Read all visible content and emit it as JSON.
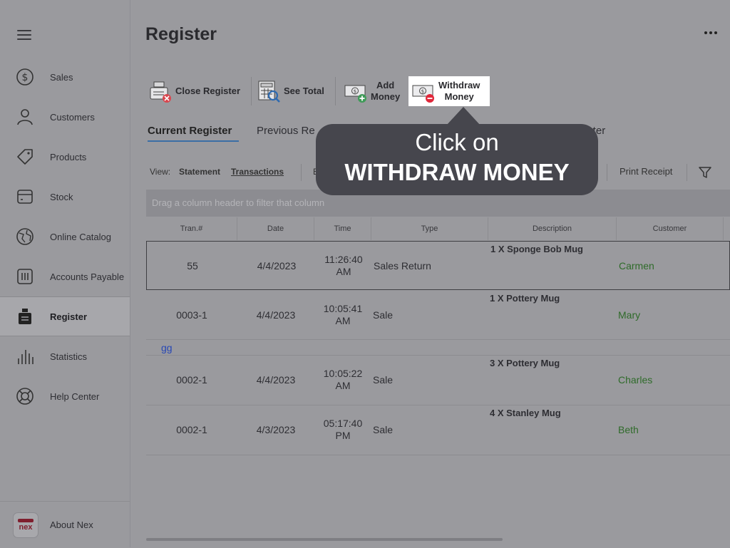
{
  "sidebar": {
    "items": [
      {
        "label": "Sales",
        "icon": "dollar-circle-icon"
      },
      {
        "label": "Customers",
        "icon": "person-icon"
      },
      {
        "label": "Products",
        "icon": "tag-icon"
      },
      {
        "label": "Stock",
        "icon": "box-icon"
      },
      {
        "label": "Online Catalog",
        "icon": "globe-icon"
      },
      {
        "label": "Accounts Payable",
        "icon": "invoice-icon"
      },
      {
        "label": "Register",
        "icon": "cash-register-icon"
      },
      {
        "label": "Statistics",
        "icon": "bar-chart-icon"
      },
      {
        "label": "Help Center",
        "icon": "lifebuoy-icon"
      }
    ],
    "active": "Register",
    "about": {
      "label": "About Nex",
      "logo_text": "nex"
    }
  },
  "header": {
    "title": "Register"
  },
  "toolbar": {
    "close_register": "Close Register",
    "see_total": "See Total",
    "add_money_1": "Add",
    "add_money_2": "Money",
    "withdraw_1": "Withdraw",
    "withdraw_2": "Money"
  },
  "tabs": {
    "current": "Current Register",
    "previous": "Previous Re",
    "counter": "unter"
  },
  "viewbar": {
    "view_label": "View:",
    "statement": "Statement",
    "transactions": "Transactions",
    "b_partial": "B",
    "print_receipt": "Print Receipt"
  },
  "grid": {
    "drag_hint": "Drag a column header to filter that column",
    "columns": [
      "Tran.#",
      "Date",
      "Time",
      "Type",
      "Description",
      "Customer"
    ],
    "rows": [
      {
        "tran": "55",
        "date": "4/4/2023",
        "time1": "11:26:40",
        "time2": "AM",
        "type": "Sales Return",
        "desc": "1 X Sponge Bob Mug",
        "customer": "Carmen"
      },
      {
        "tran": "0003-1",
        "date": "4/4/2023",
        "time1": "10:05:41",
        "time2": "AM",
        "type": "Sale",
        "desc": "1 X Pottery Mug",
        "customer": "Mary"
      },
      {
        "tran": "0002-1",
        "date": "4/4/2023",
        "time1": "10:05:22",
        "time2": "AM",
        "type": "Sale",
        "desc": "3 X Pottery Mug",
        "customer": "Charles"
      },
      {
        "tran": "0002-1",
        "date": "4/3/2023",
        "time1": "05:17:40",
        "time2": "PM",
        "type": "Sale",
        "desc": "4 X Stanley Mug",
        "customer": "Beth"
      }
    ],
    "group_label": "gg"
  },
  "tooltip": {
    "line1": "Click on",
    "line2": "WITHDRAW MONEY"
  },
  "colors": {
    "accent": "#3b6ea5",
    "customer": "#2f6b2a",
    "tooltip_bg": "#46464d",
    "brand": "#7f1f2e"
  }
}
